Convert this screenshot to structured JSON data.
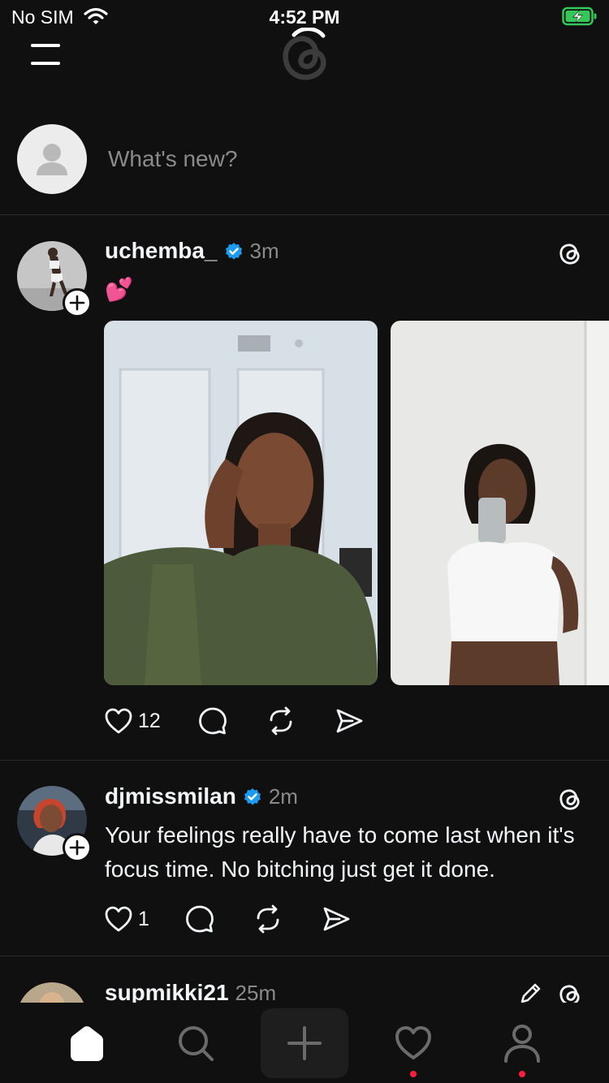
{
  "status_bar": {
    "carrier": "No SIM",
    "time": "4:52 PM"
  },
  "composer": {
    "placeholder": "What's new?"
  },
  "feed": [
    {
      "username": "uchemba_",
      "verified": true,
      "time": "3m",
      "text": "💕",
      "media_count": 2,
      "likes": "12"
    },
    {
      "username": "djmissmilan",
      "verified": true,
      "time": "2m",
      "text": "Your feelings really have to come last when it's focus time. No bitching just get it done.",
      "likes": "1"
    },
    {
      "username": "supmikki21",
      "verified": false,
      "time": "25m"
    }
  ],
  "tab_bar": {
    "tabs": [
      "home-icon",
      "search-icon",
      "compose-plus-icon",
      "activity-heart-icon",
      "profile-icon"
    ],
    "active": "home-icon"
  },
  "colors": {
    "background": "#101010",
    "verified": "#1d9bf0",
    "notification": "#ff1d3f",
    "muted": "#8a8a8a"
  }
}
